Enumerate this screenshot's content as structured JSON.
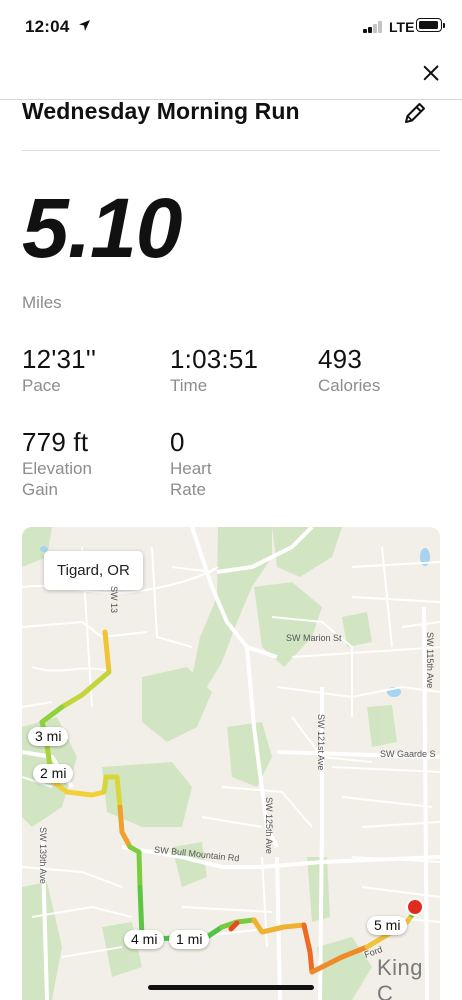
{
  "status_bar": {
    "time": "12:04",
    "network": "LTE",
    "location_icon": "location-arrow-icon",
    "battery_icon": "battery-icon",
    "signal_icon": "cellular-signal-icon"
  },
  "header": {
    "close_icon": "close-icon"
  },
  "activity": {
    "title": "Wednesday Morning Run",
    "edit_icon": "pencil-icon",
    "distance": "5.10",
    "distance_unit": "Miles",
    "stats": [
      {
        "value": "12'31''",
        "label": "Pace"
      },
      {
        "value": "1:03:51",
        "label": "Time"
      },
      {
        "value": "493",
        "label": "Calories"
      },
      {
        "value": "779 ft",
        "label": "Elevation Gain"
      },
      {
        "value": "0",
        "label": "Heart Rate"
      }
    ]
  },
  "map": {
    "place": "Tigard, OR",
    "city_label": "King C",
    "streets": {
      "marion": "SW Marion St",
      "gaarde": "SW Gaarde S",
      "bull_mountain": "SW Bull Mountain Rd",
      "ave_121": "SW 121st Ave",
      "ave_125": "SW 125th Ave",
      "ave_139": "SW 139th Ave",
      "ave_115": "SW 115th Ave",
      "ave_13x": "SW 13",
      "cut_label": "Ford"
    },
    "mile_markers": [
      "3 mi",
      "2 mi",
      "4 mi",
      "1 mi",
      "5 mi"
    ],
    "route_colors": {
      "slow": "#e84a1c",
      "mid": "#f2c335",
      "fast": "#5cc544"
    }
  }
}
